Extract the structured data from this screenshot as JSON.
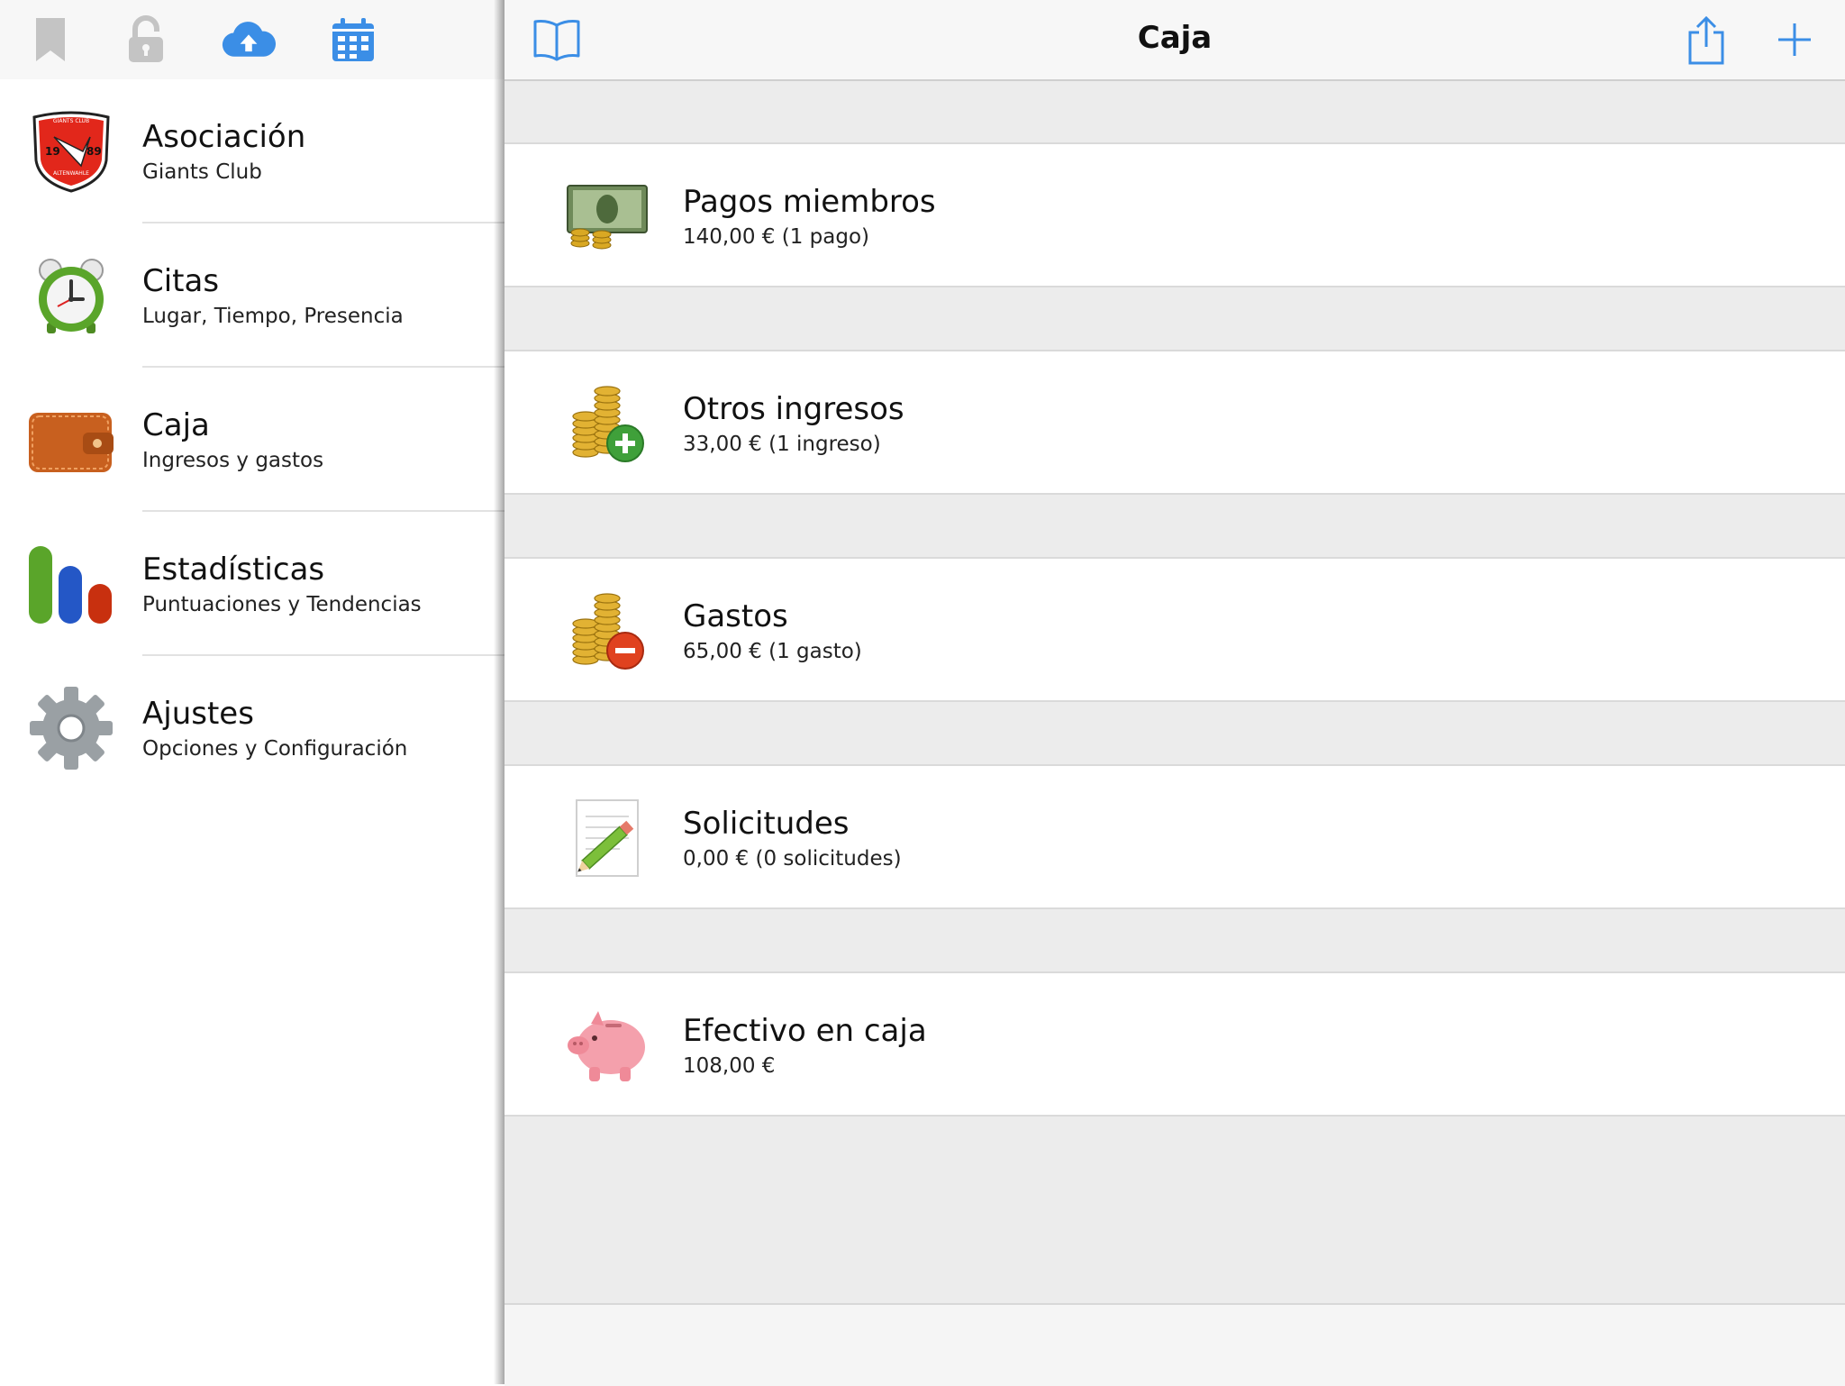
{
  "sidebar": {
    "toolbar": {
      "icons": [
        "bookmark-icon",
        "lock-icon",
        "cloud-upload-icon",
        "calendar-icon"
      ]
    },
    "items": [
      {
        "title": "Asociación",
        "subtitle": "Giants Club",
        "icon": "club-logo-icon"
      },
      {
        "title": "Citas",
        "subtitle": "Lugar, Tiempo, Presencia",
        "icon": "alarm-clock-icon"
      },
      {
        "title": "Caja",
        "subtitle": "Ingresos y gastos",
        "icon": "wallet-icon"
      },
      {
        "title": "Estadísticas",
        "subtitle": "Puntuaciones y Tendencias",
        "icon": "bar-chart-icon"
      },
      {
        "title": "Ajustes",
        "subtitle": "Opciones y Configuración",
        "icon": "gear-icon"
      }
    ],
    "logo_text": {
      "top": "GIANTS CLUB",
      "year_left": "19",
      "year_right": "89",
      "bottom": "ALTENWAHLE"
    }
  },
  "main": {
    "title": "Caja",
    "nav_icons": [
      "book-icon",
      "share-icon",
      "plus-icon"
    ],
    "rows": [
      {
        "title": "Pagos miembros",
        "subtitle": "140,00 € (1 pago)",
        "icon": "banknote-icon"
      },
      {
        "title": "Otros ingresos",
        "subtitle": "33,00 € (1 ingreso)",
        "icon": "coins-plus-icon"
      },
      {
        "title": "Gastos",
        "subtitle": "65,00 € (1 gasto)",
        "icon": "coins-minus-icon"
      },
      {
        "title": "Solicitudes",
        "subtitle": "0,00 € (0 solicitudes)",
        "icon": "document-pencil-icon"
      },
      {
        "title": "Efectivo en caja",
        "subtitle": "108,00 €",
        "icon": "piggy-bank-icon"
      }
    ]
  },
  "colors": {
    "accent": "#3b8ee6",
    "toolbar_bg": "#f7f7f7",
    "grouped_bg": "#ececec",
    "separator": "#dadada"
  }
}
